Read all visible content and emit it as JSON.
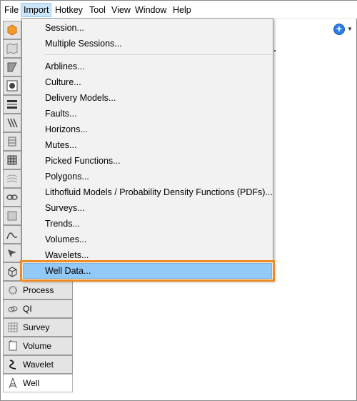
{
  "menubar": {
    "items": [
      {
        "label": "File"
      },
      {
        "label": "Import"
      },
      {
        "label": "Hotkey"
      },
      {
        "label": "Tool"
      },
      {
        "label": "View"
      },
      {
        "label": "Window"
      },
      {
        "label": "Help"
      }
    ],
    "active": "Import"
  },
  "import_menu": {
    "group1": [
      {
        "label": "Session..."
      },
      {
        "label": "Multiple Sessions..."
      }
    ],
    "group2": [
      {
        "label": "Arblines..."
      },
      {
        "label": "Culture..."
      },
      {
        "label": "Delivery Models..."
      },
      {
        "label": "Faults..."
      },
      {
        "label": "Horizons..."
      },
      {
        "label": "Mutes..."
      },
      {
        "label": "Picked Functions..."
      },
      {
        "label": "Polygons..."
      },
      {
        "label": "Lithofluid Models / Probability Density Functions (PDFs)..."
      },
      {
        "label": "Surveys..."
      },
      {
        "label": "Trends..."
      },
      {
        "label": "Volumes..."
      },
      {
        "label": "Wavelets..."
      },
      {
        "label": "Well Data..."
      }
    ],
    "highlighted": "Well Data...",
    "highlight_color": "#92c9f7",
    "callout_color": "#ef8a22"
  },
  "nav_panels": [
    {
      "label": "Process",
      "icon": "gear-icon"
    },
    {
      "label": "QI",
      "icon": "rings-icon"
    },
    {
      "label": "Survey",
      "icon": "grid-icon"
    },
    {
      "label": "Volume",
      "icon": "cube-icon"
    },
    {
      "label": "Wavelet",
      "icon": "wave-icon"
    },
    {
      "label": "Well",
      "icon": "well-derrick-icon",
      "selected": true
    }
  ],
  "strip_icons": [
    "hexagon-icon",
    "map-icon",
    "section-icon",
    "circle-icon",
    "layers-icon",
    "faults-icon",
    "horizon-icon",
    "grid-volume-icon",
    "flow-icon",
    "link-icon",
    "square-icon",
    "curve-icon",
    "arrow-icon",
    "cube-icon"
  ],
  "toolbar": {
    "add_icon": "add-circle-icon",
    "dropdown_icon": "chevron-down-icon"
  },
  "accent": "#2d7fe0"
}
